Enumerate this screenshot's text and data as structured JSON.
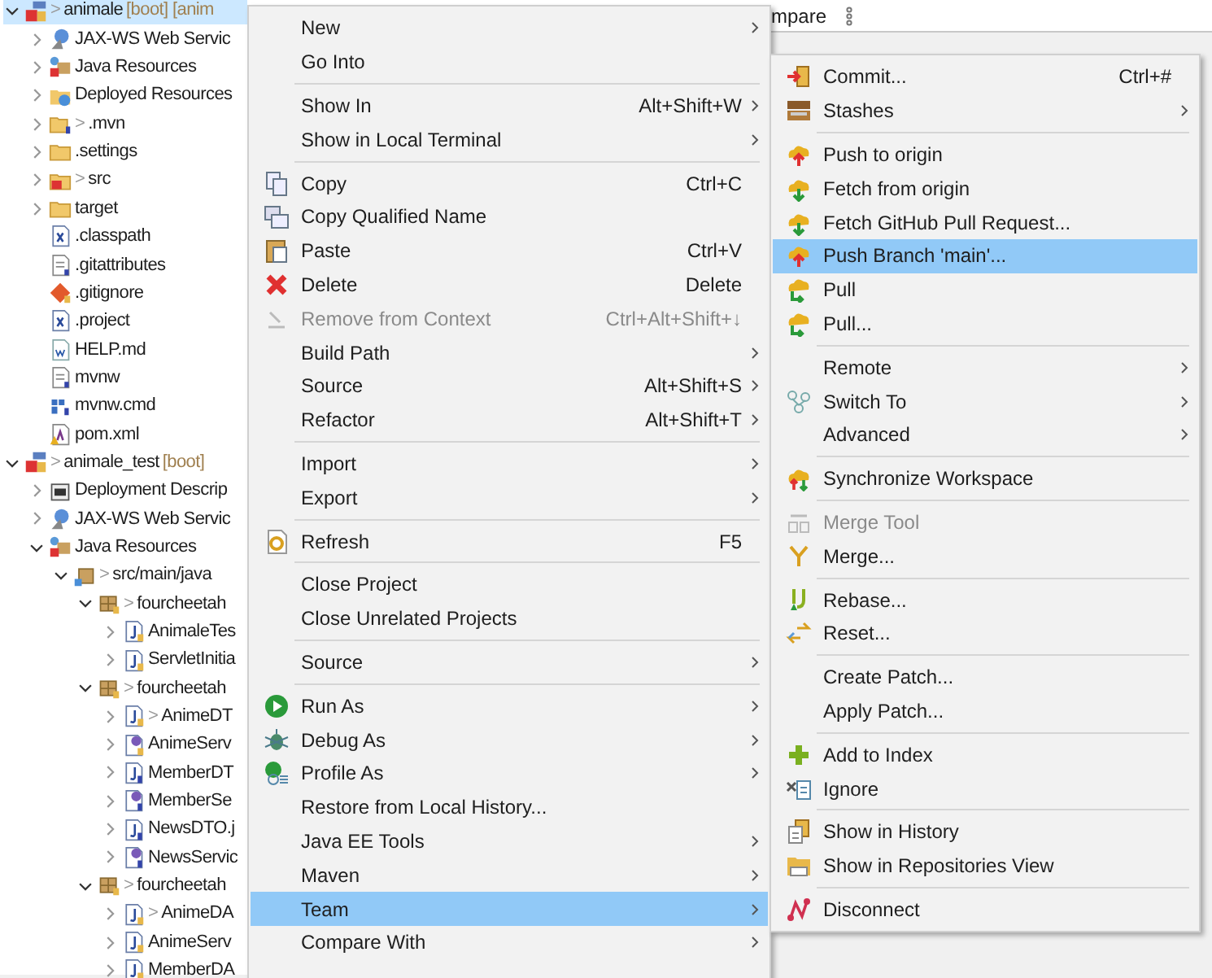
{
  "tree": [
    {
      "label": "animale",
      "marker": ">",
      "suffix": "[boot] [anim",
      "kind": "project",
      "expanded": true,
      "selected": true,
      "children": [
        {
          "label": "JAX-WS Web Servic",
          "kind": "webservice",
          "expanded": false,
          "selected": false
        },
        {
          "label": "Java Resources",
          "kind": "javares",
          "expanded": false,
          "selected": false
        },
        {
          "label": "Deployed Resources",
          "kind": "deployed",
          "expanded": false,
          "selected": false
        },
        {
          "label": ".mvn",
          "marker": ">",
          "kind": "folder-q",
          "expanded": false,
          "selected": false
        },
        {
          "label": ".settings",
          "kind": "folder",
          "expanded": false,
          "selected": false
        },
        {
          "label": "src",
          "marker": ">",
          "kind": "folder-src",
          "expanded": false,
          "selected": false
        },
        {
          "label": "target",
          "kind": "folder",
          "expanded": false,
          "selected": false
        },
        {
          "label": ".classpath",
          "kind": "xml",
          "selected": false
        },
        {
          "label": ".gitattributes",
          "kind": "textq",
          "selected": false
        },
        {
          "label": ".gitignore",
          "kind": "git",
          "selected": false
        },
        {
          "label": ".project",
          "kind": "xml",
          "selected": false
        },
        {
          "label": "HELP.md",
          "kind": "word",
          "selected": false
        },
        {
          "label": "mvnw",
          "kind": "textq",
          "selected": false
        },
        {
          "label": "mvnw.cmd",
          "kind": "cmd",
          "selected": false
        },
        {
          "label": "pom.xml",
          "kind": "pom",
          "selected": false
        }
      ]
    },
    {
      "label": "animale_test",
      "marker": ">",
      "suffix": "[boot]",
      "kind": "project",
      "expanded": true,
      "selected": false,
      "children": [
        {
          "label": "Deployment Descrip",
          "kind": "descriptor",
          "expanded": false,
          "selected": false
        },
        {
          "label": "JAX-WS Web Servic",
          "kind": "webservice",
          "expanded": false,
          "selected": false
        },
        {
          "label": "Java Resources",
          "kind": "javares",
          "expanded": true,
          "selected": false,
          "children": [
            {
              "label": "src/main/java",
              "marker": ">",
              "kind": "pkgroot",
              "expanded": true,
              "selected": false,
              "children": [
                {
                  "label": "fourcheetah",
                  "marker": ">",
                  "kind": "package",
                  "expanded": true,
                  "selected": false,
                  "children": [
                    {
                      "label": "AnimaleTes",
                      "kind": "java",
                      "expanded": false,
                      "selected": false
                    },
                    {
                      "label": "ServletInitia",
                      "kind": "java",
                      "expanded": false,
                      "selected": false
                    }
                  ]
                },
                {
                  "label": "fourcheetah",
                  "marker": ">",
                  "kind": "package",
                  "expanded": true,
                  "selected": false,
                  "children": [
                    {
                      "label": "AnimeDT",
                      "marker": ">",
                      "kind": "java",
                      "expanded": false,
                      "selected": false
                    },
                    {
                      "label": "AnimeServ",
                      "kind": "interface",
                      "expanded": false,
                      "selected": false
                    },
                    {
                      "label": "MemberDT",
                      "kind": "javaq",
                      "expanded": false,
                      "selected": false
                    },
                    {
                      "label": "MemberSe",
                      "kind": "interfaceq",
                      "expanded": false,
                      "selected": false
                    },
                    {
                      "label": "NewsDTO.j",
                      "kind": "javaq",
                      "expanded": false,
                      "selected": false
                    },
                    {
                      "label": "NewsServic",
                      "kind": "interfaceq",
                      "expanded": false,
                      "selected": false
                    }
                  ]
                },
                {
                  "label": "fourcheetah",
                  "marker": ">",
                  "kind": "package",
                  "expanded": true,
                  "selected": false,
                  "children": [
                    {
                      "label": "AnimeDA",
                      "marker": ">",
                      "kind": "java",
                      "expanded": false,
                      "selected": false
                    },
                    {
                      "label": "AnimeServ",
                      "kind": "java",
                      "expanded": false,
                      "selected": false
                    },
                    {
                      "label": "MemberDA",
                      "kind": "java",
                      "expanded": false,
                      "selected": false
                    }
                  ]
                }
              ]
            }
          ]
        }
      ]
    }
  ],
  "editor_tab": {
    "label": "mpare"
  },
  "context_menu": [
    {
      "kind": "plain",
      "label": "New",
      "submenu": true,
      "selected": false
    },
    {
      "kind": "plain",
      "label": "Go Into",
      "selected": false
    },
    {
      "kind": "separator"
    },
    {
      "kind": "plain",
      "label": "Show In",
      "shortcut": "Alt+Shift+W",
      "submenu": true,
      "selected": false
    },
    {
      "kind": "plain",
      "label": "Show in Local Terminal",
      "submenu": true,
      "selected": false
    },
    {
      "kind": "separator"
    },
    {
      "kind": "copy",
      "label": "Copy",
      "shortcut": "Ctrl+C",
      "selected": false
    },
    {
      "kind": "copyname",
      "label": "Copy Qualified Name",
      "selected": false
    },
    {
      "kind": "paste",
      "label": "Paste",
      "shortcut": "Ctrl+V",
      "selected": false
    },
    {
      "kind": "delete",
      "label": "Delete",
      "shortcut": "Delete",
      "selected": false
    },
    {
      "kind": "remove",
      "label": "Remove from Context",
      "shortcut": "Ctrl+Alt+Shift+↓",
      "disabled": true,
      "selected": false
    },
    {
      "kind": "plain",
      "label": "Build Path",
      "submenu": true,
      "selected": false
    },
    {
      "kind": "plain",
      "label": "Source",
      "shortcut": "Alt+Shift+S",
      "submenu": true,
      "selected": false
    },
    {
      "kind": "plain",
      "label": "Refactor",
      "shortcut": "Alt+Shift+T",
      "submenu": true,
      "selected": false
    },
    {
      "kind": "separator"
    },
    {
      "kind": "plain",
      "label": "Import",
      "submenu": true,
      "selected": false
    },
    {
      "kind": "plain",
      "label": "Export",
      "submenu": true,
      "selected": false
    },
    {
      "kind": "separator"
    },
    {
      "kind": "refresh",
      "label": "Refresh",
      "shortcut": "F5",
      "selected": false
    },
    {
      "kind": "separator"
    },
    {
      "kind": "plain",
      "label": "Close Project",
      "selected": false
    },
    {
      "kind": "plain",
      "label": "Close Unrelated Projects",
      "selected": false
    },
    {
      "kind": "separator"
    },
    {
      "kind": "plain",
      "label": "Source",
      "submenu": true,
      "selected": false
    },
    {
      "kind": "separator"
    },
    {
      "kind": "run",
      "label": "Run As",
      "submenu": true,
      "selected": false
    },
    {
      "kind": "debug",
      "label": "Debug As",
      "submenu": true,
      "selected": false
    },
    {
      "kind": "profile",
      "label": "Profile As",
      "submenu": true,
      "selected": false
    },
    {
      "kind": "plain",
      "label": "Restore from Local History...",
      "selected": false
    },
    {
      "kind": "plain",
      "label": "Java EE Tools",
      "submenu": true,
      "selected": false
    },
    {
      "kind": "plain",
      "label": "Maven",
      "submenu": true,
      "selected": false
    },
    {
      "kind": "plain",
      "label": "Team",
      "submenu": true,
      "selected": true
    },
    {
      "kind": "plain",
      "label": "Compare With",
      "submenu": true,
      "selected": false
    }
  ],
  "team_menu": [
    {
      "kind": "commit",
      "label": "Commit...",
      "shortcut": "Ctrl+#",
      "selected": false
    },
    {
      "kind": "stash",
      "label": "Stashes",
      "submenu": true,
      "selected": false
    },
    {
      "kind": "separator"
    },
    {
      "kind": "push",
      "label": "Push to origin",
      "selected": false
    },
    {
      "kind": "fetch",
      "label": "Fetch from origin",
      "selected": false
    },
    {
      "kind": "fetch",
      "label": "Fetch GitHub Pull Request...",
      "selected": false
    },
    {
      "kind": "push",
      "label": "Push Branch 'main'...",
      "selected": true
    },
    {
      "kind": "pull",
      "label": "Pull",
      "selected": false
    },
    {
      "kind": "pull",
      "label": "Pull...",
      "selected": false
    },
    {
      "kind": "separator"
    },
    {
      "kind": "plain",
      "label": "Remote",
      "submenu": true,
      "selected": false
    },
    {
      "kind": "switch",
      "label": "Switch To",
      "submenu": true,
      "selected": false
    },
    {
      "kind": "plain",
      "label": "Advanced",
      "submenu": true,
      "selected": false
    },
    {
      "kind": "separator"
    },
    {
      "kind": "sync",
      "label": "Synchronize Workspace",
      "selected": false
    },
    {
      "kind": "separator"
    },
    {
      "kind": "mergetool",
      "label": "Merge Tool",
      "disabled": true,
      "selected": false
    },
    {
      "kind": "merge",
      "label": "Merge...",
      "selected": false
    },
    {
      "kind": "separator"
    },
    {
      "kind": "rebase",
      "label": "Rebase...",
      "selected": false
    },
    {
      "kind": "reset",
      "label": "Reset...",
      "selected": false
    },
    {
      "kind": "separator"
    },
    {
      "kind": "plain",
      "label": "Create Patch...",
      "selected": false
    },
    {
      "kind": "plain",
      "label": "Apply Patch...",
      "selected": false
    },
    {
      "kind": "separator"
    },
    {
      "kind": "add",
      "label": "Add to Index",
      "selected": false
    },
    {
      "kind": "ignore",
      "label": "Ignore",
      "selected": false
    },
    {
      "kind": "separator"
    },
    {
      "kind": "history",
      "label": "Show in History",
      "selected": false
    },
    {
      "kind": "repos",
      "label": "Show in Repositories View",
      "selected": false
    },
    {
      "kind": "separator"
    },
    {
      "kind": "disconnect",
      "label": "Disconnect",
      "selected": false
    }
  ]
}
